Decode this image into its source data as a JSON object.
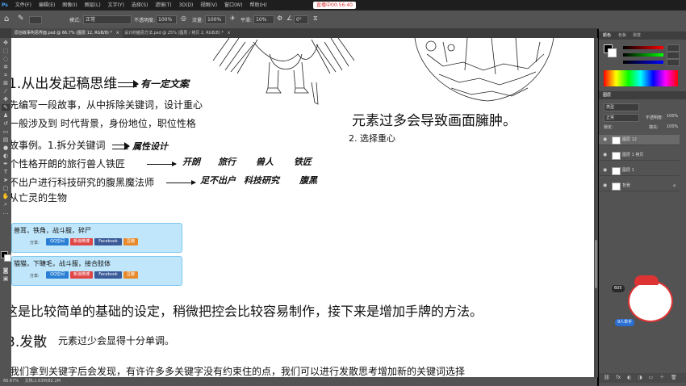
{
  "menubar": {
    "items": [
      "文件(F)",
      "编辑(E)",
      "图像(I)",
      "图层(L)",
      "文字(Y)",
      "选择(S)",
      "滤镜(T)",
      "3D(D)",
      "视图(V)",
      "窗口(W)",
      "帮助(H)"
    ],
    "stream_badge": "直播中00:56:40"
  },
  "options": {
    "mode_label": "模式:",
    "mode_value": "正常",
    "opacity_label": "不透明度:",
    "opacity_value": "100%",
    "flow_label": "流量:",
    "flow_value": "100%",
    "smooth_label": "平滑:",
    "smooth_value": "10%",
    "angle_value": "0°"
  },
  "tabs": [
    {
      "label": "原创故事构思界面.psd @ 66.7% (图层 12, RGB/8) *"
    },
    {
      "label": "设计的脑思方法.psd @ 25% (图层 / 拷贝 2, RGB/8) *"
    }
  ],
  "canvas": {
    "heading1": "1.从出发起稿思维",
    "arrow1_note": "有一定文案",
    "line1": "先编写一段故事，从中拆除关键词，设计重心",
    "line2": "一般涉及到 时代背景，身份地位，职位性格",
    "example": "故事例。1.拆分关键词",
    "example_note": "属性设计",
    "row1_text": "个性格开朗的旅行兽人铁匠",
    "row1_notes": [
      "开朗",
      "旅行",
      "兽人",
      "铁匠"
    ],
    "row2_text": "不出户进行科技研究的腹黑魔法师",
    "row2_notes": [
      "足不出户",
      "科技研究",
      "腹黑"
    ],
    "row3_text": "从亡灵的生物",
    "right_heading": "元素过多会导致画面臃肿。",
    "right_sub": "2. 选择重心",
    "card1": {
      "title": "兽耳，铁角，战斗服，碎尸",
      "share_label": "分享:",
      "buttons": [
        {
          "label": "QQ空间",
          "color": "#2a7fd4"
        },
        {
          "label": "新浪微博",
          "color": "#e04646"
        },
        {
          "label": "Facebook",
          "color": "#3b5a98"
        },
        {
          "label": "豆瓣",
          "color": "#e8892b"
        }
      ]
    },
    "card2": {
      "title": "猫猫，下睫毛，战斗服，接合肢体",
      "share_label": "分享:",
      "buttons": [
        {
          "label": "QQ空间",
          "color": "#2a7fd4"
        },
        {
          "label": "新浪微博",
          "color": "#e04646"
        },
        {
          "label": "Facebook",
          "color": "#3b5a98"
        },
        {
          "label": "豆瓣",
          "color": "#e8892b"
        }
      ]
    },
    "bottom_line1": "这是比较简单的基础的设定，稍微把控会比较容易制作，接下来是增加手牌的方法。",
    "heading2": "3.发散",
    "heading2_note": "元素过少会显得十分单调。",
    "bottom_line2": "我们拿到关键字后会发现，有许许多多关键字没有约束住的点，我们可以进行发散思考增加新的关键词选择"
  },
  "statusbar": {
    "zoom": "66.67%",
    "doc": "文档:2.63M/82.2M"
  },
  "panel": {
    "color_tabs": [
      "颜色",
      "色板",
      "渐变"
    ],
    "layer_tabs": [
      "图层",
      "通道",
      "路径"
    ],
    "kind_label": "类型",
    "blend_mode": "正常",
    "opacity_label": "不透明度:",
    "opacity_value": "100%",
    "lock_label": "锁定:",
    "fill_label": "填充:",
    "fill_value": "100%",
    "layers": [
      {
        "name": "图层 12",
        "selected": true
      },
      {
        "name": "图层 1 拷贝",
        "selected": false
      },
      {
        "name": "图层 1",
        "selected": false
      },
      {
        "name": "背景",
        "selected": false
      }
    ]
  },
  "overlay": {
    "viewer_count": "605",
    "handraise": "9人举手"
  },
  "colors": {
    "fg": "#000000",
    "bg": "#ffffff",
    "canvas": "#ffffff",
    "ui_dark": "#535353"
  }
}
